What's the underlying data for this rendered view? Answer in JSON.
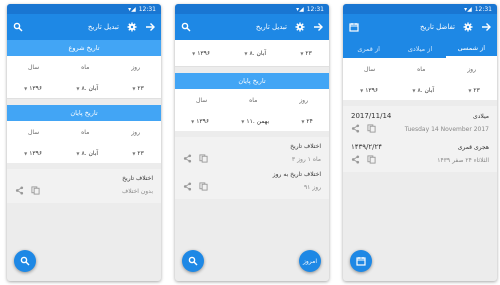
{
  "status": {
    "time": "12:31"
  },
  "screen1": {
    "title": "تبدیل تاریخ",
    "start_label": "تاریخ شروع",
    "end_label": "تاریخ پایان",
    "col_day": "روز",
    "col_month": "ماه",
    "col_year": "سال",
    "start_date": {
      "day": "۲۳",
      "month": "۸. آبان",
      "year": "۱۳۹۶"
    },
    "end_date": {
      "day": "۲۳",
      "month": "۸. آبان",
      "year": "۱۳۹۶"
    },
    "diff_title": "اختلاف تاریخ",
    "diff_value": "بدون اختلاف"
  },
  "screen2": {
    "title": "تبدیل تاریخ",
    "start_date": {
      "day": "۲۳",
      "month": "۸. آبان",
      "year": "۱۳۹۶"
    },
    "end_label": "تاریخ پایان",
    "col_day": "روز",
    "col_month": "ماه",
    "col_year": "سال",
    "end_date": {
      "day": "۲۴",
      "month": "۱۱. بهمن",
      "year": "۱۳۹۶"
    },
    "diff_title": "اختلاف تاریخ",
    "diff_value": "۳ ماه ۱ روز",
    "diff_days_title": "اختلاف تاریخ به روز",
    "diff_days_value": "۹۱ روز",
    "fab_label": "امروز"
  },
  "screen3": {
    "title": "تفاضل تاریخ",
    "tabs": [
      "از شمسی",
      "از میلادی",
      "از قمری"
    ],
    "col_day": "روز",
    "col_month": "ماه",
    "col_year": "سال",
    "date": {
      "day": "۲۳",
      "month": "۸. آبان",
      "year": "۱۳۹۶"
    },
    "gregorian_label": "میلادی",
    "gregorian_short": "2017/11/14",
    "gregorian_long": "Tuesday 14 November 2017",
    "hijri_label": "هجری قمری",
    "hijri_short": "۱۴۳۹/۲/۲۴",
    "hijri_long": "الثلاثاء ۲۴ صفر ۱۴۳۹"
  },
  "colors": {
    "primary": "#1e88e5",
    "primary_dark": "#1976d2",
    "band": "#42a5f5"
  }
}
